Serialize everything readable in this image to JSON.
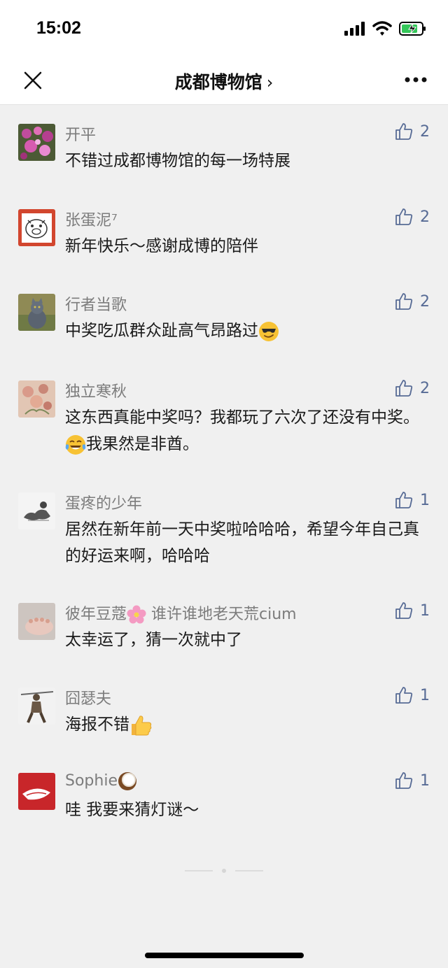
{
  "status": {
    "time": "15:02"
  },
  "nav": {
    "title": "成都博物馆",
    "chevron": "›"
  },
  "comments": [
    {
      "name": "开平",
      "text": "不错过成都博物馆的每一场特展",
      "likes": "2"
    },
    {
      "name": "张蛋泥⁷",
      "text": "新年快乐～感谢成博的陪伴",
      "likes": "2"
    },
    {
      "name": "行者当歌",
      "text": "中奖吃瓜群众趾高气昂路过",
      "likes": "2"
    },
    {
      "name": "独立寒秋",
      "text_a": "这东西真能中奖吗？我都玩了六次了还没有中奖。",
      "text_b": "我果然是非酋。",
      "likes": "2"
    },
    {
      "name": "蛋疼的少年",
      "text": "居然在新年前一天中奖啦哈哈哈，希望今年自己真的好运来啊，哈哈哈",
      "likes": "1"
    },
    {
      "name_a": "彼年豆蔻",
      "name_b": " 谁许谁地老天荒cium",
      "text": "太幸运了，猜一次就中了",
      "likes": "1"
    },
    {
      "name": "囧瑟夫",
      "text": "海报不错",
      "likes": "1"
    },
    {
      "name": "Sophie",
      "text": "哇 我要来猜灯谜～",
      "likes": "1"
    }
  ]
}
